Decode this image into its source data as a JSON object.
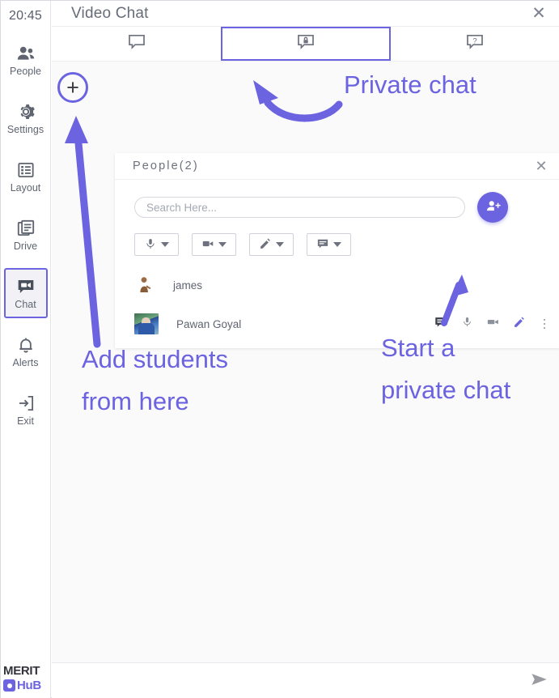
{
  "sidebar": {
    "clock": "20:45",
    "items": [
      {
        "label": "People",
        "icon": "people-icon",
        "active": false
      },
      {
        "label": "Settings",
        "icon": "gear-icon",
        "active": false
      },
      {
        "label": "Layout",
        "icon": "layout-icon",
        "active": false
      },
      {
        "label": "Drive",
        "icon": "drive-icon",
        "active": false
      },
      {
        "label": "Chat",
        "icon": "chat-icon",
        "active": true
      },
      {
        "label": "Alerts",
        "icon": "bell-icon",
        "active": false
      },
      {
        "label": "Exit",
        "icon": "exit-icon",
        "active": false
      }
    ],
    "brand": {
      "line1": "MERIT",
      "line2": "HuB"
    }
  },
  "window": {
    "title": "Video Chat",
    "close_icon": "✕"
  },
  "tabs": [
    {
      "name": "public-chat",
      "icon": "chat-bubble-icon",
      "active": false
    },
    {
      "name": "private-chat",
      "icon": "lock-bubble-icon",
      "active": true
    },
    {
      "name": "help-chat",
      "icon": "question-bubble-icon",
      "active": false
    }
  ],
  "people_panel": {
    "title": "People(2)",
    "close_icon": "✕",
    "search": {
      "placeholder": "Search Here...",
      "value": ""
    },
    "add_person_label": "add-person",
    "filters": [
      {
        "name": "mic-filter",
        "icon": "microphone-icon"
      },
      {
        "name": "camera-filter",
        "icon": "video-camera-icon"
      },
      {
        "name": "pencil-filter",
        "icon": "pencil-icon"
      },
      {
        "name": "chat-filter",
        "icon": "chat-square-icon"
      }
    ],
    "people": [
      {
        "name": "james",
        "avatar": "default-person-avatar",
        "has_actions": false
      },
      {
        "name": "Pawan Goyal",
        "avatar": "photo-thumbnail",
        "has_actions": true,
        "actions": [
          {
            "name": "private-chat-icon",
            "state": "active"
          },
          {
            "name": "microphone-icon",
            "state": "normal"
          },
          {
            "name": "video-camera-icon",
            "state": "normal"
          },
          {
            "name": "pencil-icon",
            "state": "highlight"
          },
          {
            "name": "more-options-icon",
            "state": "normal"
          }
        ]
      }
    ]
  },
  "message_bar": {
    "placeholder": "",
    "value": "",
    "send_icon": "send-icon"
  },
  "annotations": {
    "private_chat": "Private chat",
    "add_students": "Add students\nfrom here",
    "start_private_chat": "Start a\nprivate chat",
    "plus_symbol": "+"
  },
  "colors": {
    "accent": "#6b63e0",
    "text": "#5f6470",
    "panel_bg": "#ffffff",
    "content_bg": "#fafafb"
  }
}
